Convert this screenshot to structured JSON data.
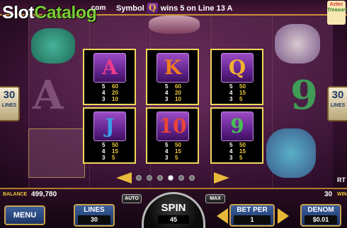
{
  "header": {
    "brand_part1": "Slot",
    "brand_part2": "Catalog",
    "brand_domain": ".com",
    "win_message_pre": "Symbol",
    "win_symbol": "Q",
    "win_message_post": "wins 5 on Line 13 A",
    "logo_line1": "Aztec",
    "logo_line2": "Treasure"
  },
  "side_lines": {
    "left_count": "30",
    "left_label": "LINES",
    "right_count": "30",
    "right_label": "LINES"
  },
  "paytable": [
    {
      "symbol": "A",
      "color": "#ee3a8c",
      "pays": [
        {
          "count": "5",
          "value": "60"
        },
        {
          "count": "4",
          "value": "20"
        },
        {
          "count": "3",
          "value": "10"
        }
      ]
    },
    {
      "symbol": "K",
      "color": "#f07a1f",
      "pays": [
        {
          "count": "5",
          "value": "60"
        },
        {
          "count": "4",
          "value": "20"
        },
        {
          "count": "3",
          "value": "10"
        }
      ]
    },
    {
      "symbol": "Q",
      "color": "#f2b22e",
      "pays": [
        {
          "count": "5",
          "value": "50"
        },
        {
          "count": "4",
          "value": "15"
        },
        {
          "count": "3",
          "value": "5"
        }
      ]
    },
    {
      "symbol": "J",
      "color": "#3aa0e8",
      "pays": [
        {
          "count": "5",
          "value": "50"
        },
        {
          "count": "4",
          "value": "15"
        },
        {
          "count": "3",
          "value": "5"
        }
      ]
    },
    {
      "symbol": "10",
      "color": "#e8443a",
      "pays": [
        {
          "count": "5",
          "value": "50"
        },
        {
          "count": "4",
          "value": "15"
        },
        {
          "count": "3",
          "value": "5"
        }
      ]
    },
    {
      "symbol": "9",
      "color": "#47c253",
      "pays": [
        {
          "count": "5",
          "value": "50"
        },
        {
          "count": "4",
          "value": "15"
        },
        {
          "count": "3",
          "value": "5"
        }
      ]
    }
  ],
  "pager": {
    "pages": 6,
    "active_page": 4
  },
  "right_edge_label": "RT",
  "panel": {
    "balance_label": "BALANCE",
    "balance_value": "499,780",
    "lines_count": "30",
    "lines_word": "WIN",
    "menu_label": "MENU",
    "lines_label": "LINES",
    "lines_value": "30",
    "auto_label": "AUTO",
    "spin_label": "SPIN",
    "spin_value": "45",
    "max_label": "MAX",
    "betper_label": "BET PER",
    "betper_value": "1",
    "denom_label": "DENOM",
    "denom_value": "$0.01"
  }
}
